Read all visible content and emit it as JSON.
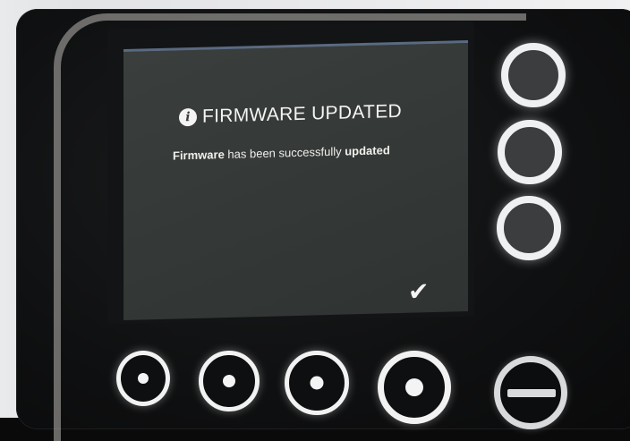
{
  "screen": {
    "title": "FIRMWARE UPDATED",
    "message_bold_start": "Firmware",
    "message_middle": " has been successfully ",
    "message_bold_end": "updated",
    "confirm_glyph": "✔"
  },
  "icons": {
    "info": "info-icon",
    "confirm": "check-icon",
    "power": "power-icon"
  },
  "colors": {
    "screen_bg": "#383c3a",
    "screen_text": "#f4f4f2",
    "button_ring": "#eef0f2",
    "device_body": "#0f1011"
  }
}
